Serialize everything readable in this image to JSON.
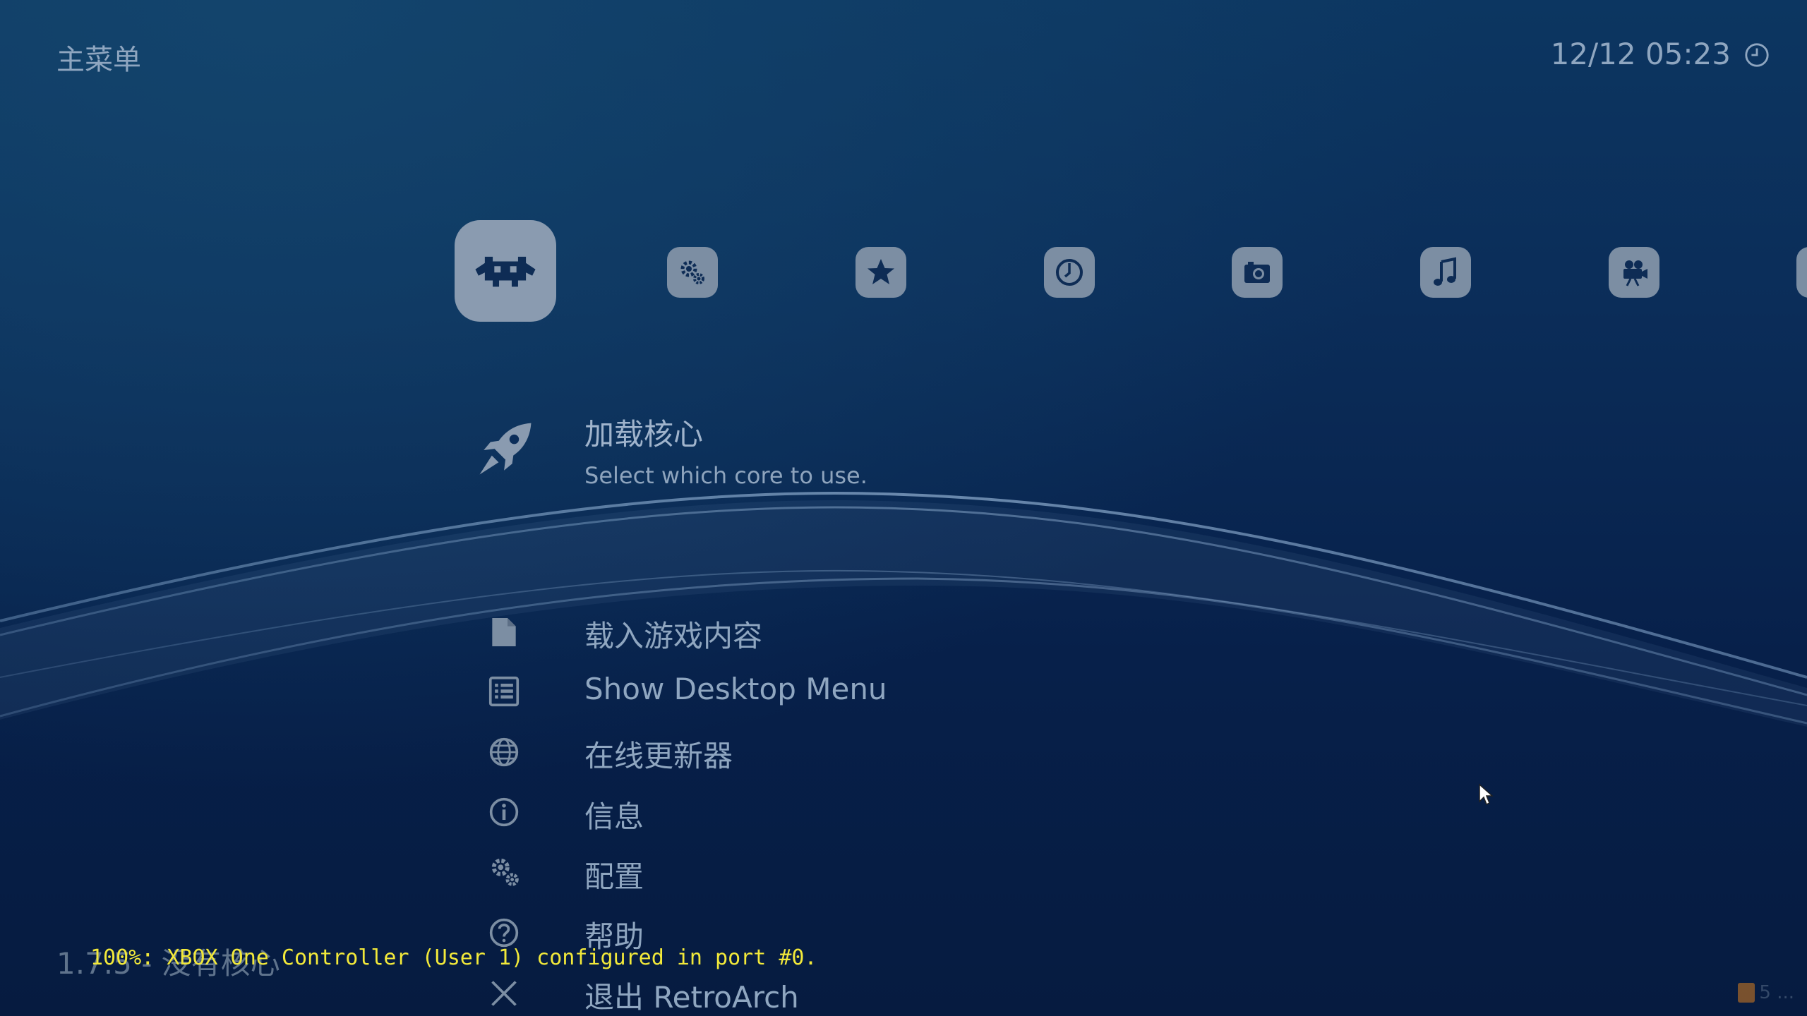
{
  "header": {
    "title": "主菜单",
    "clock": "12/12 05:23"
  },
  "tabs": [
    {
      "icon": "retroarch-invader-icon",
      "active": true
    },
    {
      "icon": "settings-gears-icon"
    },
    {
      "icon": "favorites-star-icon"
    },
    {
      "icon": "history-clock-icon"
    },
    {
      "icon": "images-camera-icon"
    },
    {
      "icon": "music-note-icon"
    },
    {
      "icon": "video-camera-icon"
    },
    {
      "icon": "partial-tab-icon"
    }
  ],
  "menu": {
    "selected": {
      "label": "加载核心",
      "sublabel": "Select which core to use.",
      "icon": "rocket-icon"
    },
    "items": [
      {
        "label": "载入游戏内容",
        "icon": "file-icon"
      },
      {
        "label": "Show Desktop Menu",
        "icon": "list-icon"
      },
      {
        "label": "在线更新器",
        "icon": "globe-icon"
      },
      {
        "label": "信息",
        "icon": "info-icon"
      },
      {
        "label": "配置",
        "icon": "settings-icon"
      },
      {
        "label": "帮助",
        "icon": "help-icon"
      },
      {
        "label": "退出 RetroArch",
        "icon": "close-icon"
      }
    ]
  },
  "footer": {
    "version": "1.7.5 - 没有核心",
    "osd_message": "100%: XBOX One Controller (User 1) configured in port #0.",
    "watermark": "5 ..."
  },
  "colors": {
    "text": "#8fa6c0",
    "icon": "#7c8ea3",
    "osd": "#f2e93a",
    "background": "#07204a"
  }
}
